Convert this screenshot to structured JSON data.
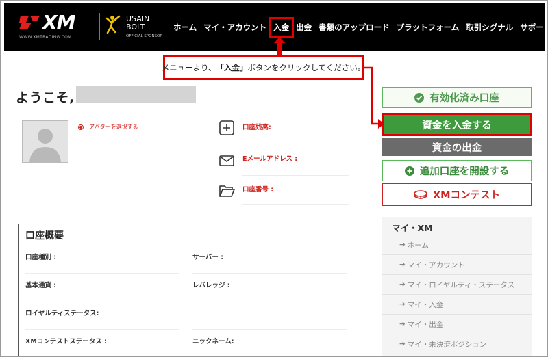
{
  "header": {
    "logo_text": "XM",
    "logo_url": "WWW.XMTRADING.COM",
    "sponsor_line1": "USAIN",
    "sponsor_line2": "BOLT",
    "sponsor_tag": "OFFICIAL SPONSOR",
    "nav": [
      {
        "label": "ホーム",
        "highlighted": false
      },
      {
        "label": "マイ・アカウント",
        "highlighted": false
      },
      {
        "label": "入金",
        "highlighted": true
      },
      {
        "label": "出金",
        "highlighted": false
      },
      {
        "label": "書類のアップロード",
        "highlighted": false
      },
      {
        "label": "プラットフォーム",
        "highlighted": false
      },
      {
        "label": "取引シグナル",
        "highlighted": false
      },
      {
        "label": "サポート",
        "highlighted": false
      }
    ]
  },
  "callout": {
    "prefix": "メニューより、",
    "emphasis": "「入金」",
    "suffix": "ボタンをクリックしてください。"
  },
  "welcome": {
    "greeting": "ようこそ,"
  },
  "profile": {
    "avatar_link": "アバターを選択する",
    "balance_label": "口座残高:",
    "email_label": "Eメールアドレス :",
    "account_number_label": "口座番号 :"
  },
  "actions": {
    "verified": "有効化済み口座",
    "deposit": "資金を入金する",
    "withdraw": "資金の出金",
    "open_account": "追加口座を開設する",
    "contest": "XMコンテスト"
  },
  "my_menu": {
    "title": "マイ・XM",
    "items": [
      "ホーム",
      "マイ・アカウント",
      "マイ・ロイヤルティ・ステータス",
      "マイ・入金",
      "マイ・出金",
      "マイ・未決済ポジション"
    ]
  },
  "overview": {
    "title": "口座概要",
    "account_type": "口座種別 :",
    "server": "サーバー :",
    "base_currency": "基本通貨 :",
    "leverage": "レバレッジ :",
    "loyalty_status": "ロイヤルティステータス:",
    "contest_status": "XMコンテストステータス :",
    "nickname": "ニックネーム:"
  },
  "colors": {
    "highlight_red": "#e00000",
    "deposit_green": "#3d9a3d",
    "withdraw_gray": "#6b6b6b",
    "link_red": "#d0231f"
  }
}
